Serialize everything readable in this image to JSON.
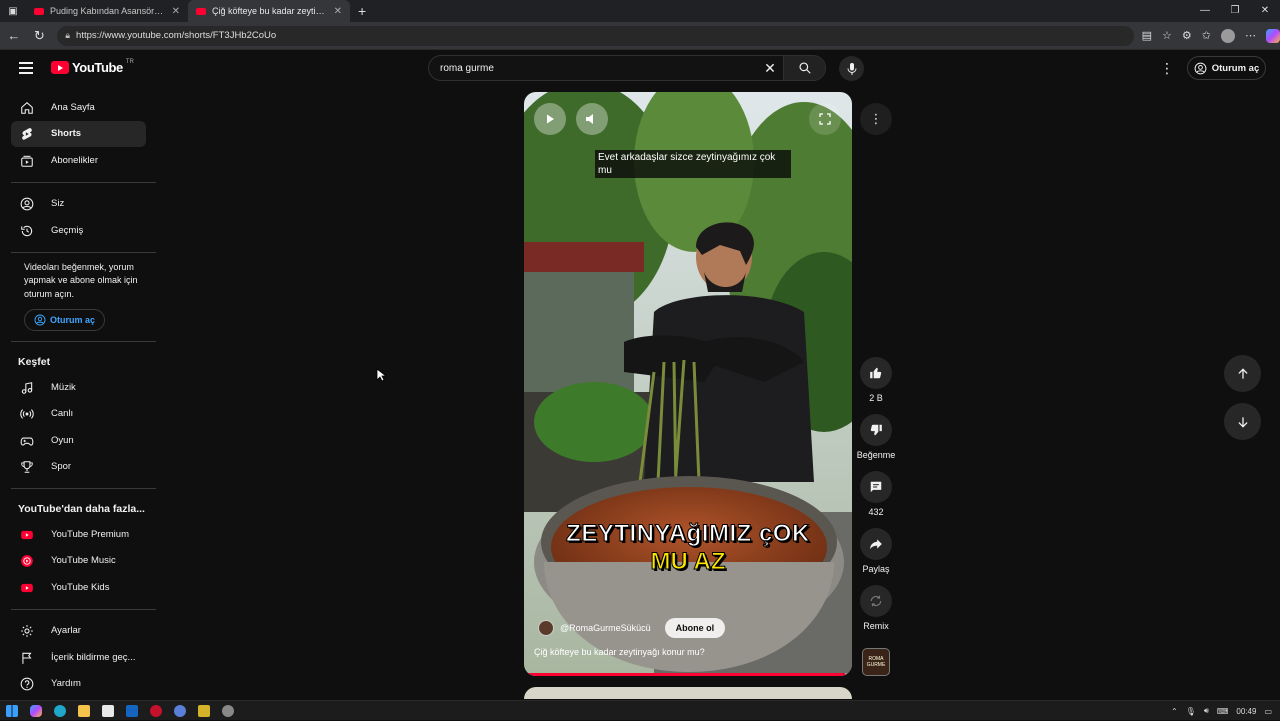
{
  "browser": {
    "tabs": [
      {
        "label": "Puding Kabından Asansöre, Japon"
      },
      {
        "label": "Çiğ köfteye bu kadar zeytinyağı k"
      }
    ],
    "new_tab": "+",
    "url": "https://www.youtube.com/shorts/FT3JHb2CoUo"
  },
  "header": {
    "logo_text": "YouTube",
    "country_code": "TR",
    "search_value": "roma gurme",
    "sign_in": "Oturum aç"
  },
  "sidebar": {
    "main": [
      {
        "label": "Ana Sayfa",
        "icon": "home-icon"
      },
      {
        "label": "Shorts",
        "icon": "shorts-icon"
      },
      {
        "label": "Abonelikler",
        "icon": "subscriptions-icon"
      }
    ],
    "you": [
      {
        "label": "Siz",
        "icon": "user-icon"
      },
      {
        "label": "Geçmiş",
        "icon": "history-icon"
      }
    ],
    "promo_text": "Videoları beğenmek, yorum yapmak ve abone olmak için oturum açın.",
    "promo_button": "Oturum aç",
    "explore_title": "Keşfet",
    "explore": [
      {
        "label": "Müzik",
        "icon": "music-icon"
      },
      {
        "label": "Canlı",
        "icon": "live-icon"
      },
      {
        "label": "Oyun",
        "icon": "gaming-icon"
      },
      {
        "label": "Spor",
        "icon": "trophy-icon"
      }
    ],
    "more_title": "YouTube'dan daha fazla...",
    "more": [
      {
        "label": "YouTube Premium"
      },
      {
        "label": "YouTube Music"
      },
      {
        "label": "YouTube Kids"
      }
    ],
    "bottom": [
      {
        "label": "Ayarlar",
        "icon": "settings-icon"
      },
      {
        "label": "İçerik bildirme geç...",
        "icon": "flag-icon"
      },
      {
        "label": "Yardım",
        "icon": "help-icon"
      }
    ]
  },
  "short": {
    "caption": "Evet arkadaşlar sizce zeytinyağımız çok mu",
    "overlay_line1": "ZEYTINYAğIMIZ çOK",
    "overlay_line2": "MU AZ",
    "channel": "@RomaGurmeSükücü",
    "subscribe": "Abone ol",
    "title": "Çiğ köfteye bu kadar zeytinyağı konur mu?",
    "progress": 0.98
  },
  "actions": {
    "like_count": "2 B",
    "dislike_label": "Beğenme",
    "comment_count": "432",
    "share_label": "Paylaş",
    "remix_label": "Remix",
    "channel_avatar_text": "ROMA GURME"
  },
  "taskbar": {
    "time": "00:49"
  },
  "colors": {
    "accent": "#ff0033",
    "link": "#3ea6ff",
    "background": "#0f0f0f"
  }
}
